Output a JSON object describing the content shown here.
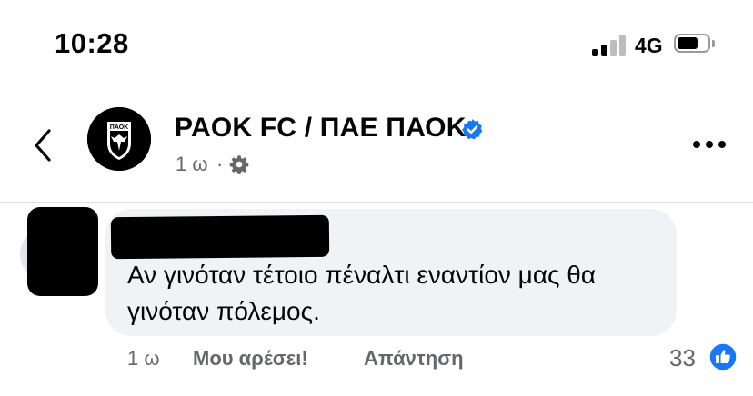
{
  "status_bar": {
    "time": "10:28",
    "network": "4G"
  },
  "post_header": {
    "page_name": "PAOK FC / ΠΑΕ ΠΑΟΚ",
    "time": "1 ω",
    "separator": "·",
    "avatar_text": "ΠΑΟΚ",
    "verified_color": "#1877f2"
  },
  "comment": {
    "text": "Αν γινόταν τέτοιο πέναλτι εναντίον μας θα γινόταν πόλεμος.",
    "time": "1 ω",
    "like_label": "Μου αρέσει!",
    "reply_label": "Απάντηση",
    "reaction_count": "33",
    "reaction_icon": "thumbs-up-icon"
  }
}
